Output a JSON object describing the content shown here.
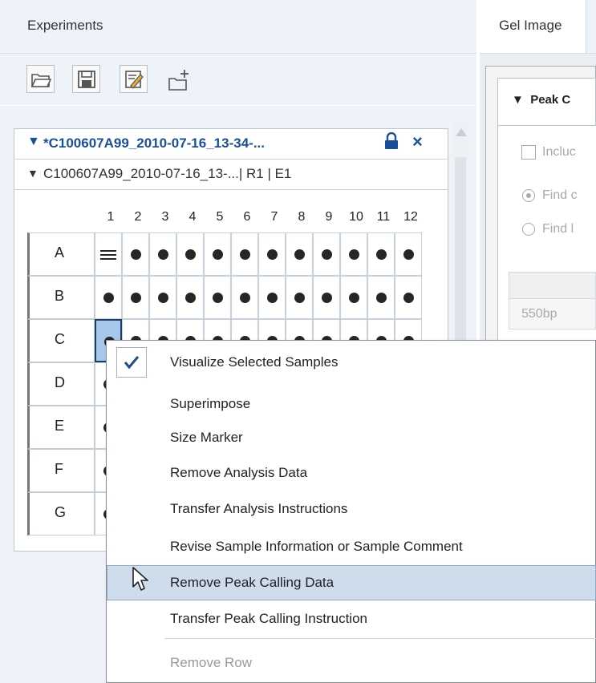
{
  "left_panel": {
    "header": {
      "title": "Experiments"
    },
    "toolbar": {
      "icons": [
        "open-folder-icon",
        "save-icon",
        "edit-icon",
        "new-experiment-icon"
      ]
    },
    "experiment": {
      "title": "*C100607A99_2010-07-16_13-34-...",
      "subtitle": "C100607A99_2010-07-16_13-...| R1 | E1"
    },
    "plate": {
      "columns": [
        "1",
        "2",
        "3",
        "4",
        "5",
        "6",
        "7",
        "8",
        "9",
        "10",
        "11",
        "12"
      ],
      "rows": [
        {
          "label": "A"
        },
        {
          "label": "B"
        },
        {
          "label": "C"
        },
        {
          "label": "D"
        },
        {
          "label": "E"
        },
        {
          "label": "F"
        },
        {
          "label": "G"
        }
      ]
    }
  },
  "right_panel": {
    "header": {
      "tab": "Gel Image"
    },
    "peak_section": {
      "title": "Peak C",
      "checkbox_label": "Incluc",
      "radio_1": "Find c",
      "radio_2": "Find l",
      "table_value": "550bp"
    }
  },
  "context_menu": {
    "items": [
      {
        "label": "Visualize Selected Samples",
        "checked": true
      },
      {
        "label": "Superimpose"
      },
      {
        "label": "Size Marker"
      },
      {
        "label": "Remove Analysis Data"
      },
      {
        "label": "Transfer Analysis Instructions"
      },
      {
        "label": "Revise Sample Information or Sample Comment"
      },
      {
        "label": "Remove Peak Calling Data",
        "highlighted": true
      },
      {
        "label": "Transfer Peak Calling Instruction"
      },
      {
        "label": "Remove Row",
        "disabled": true
      }
    ]
  },
  "colors": {
    "accent": "#1b4e9a",
    "panel_bg": "#eef3f9",
    "selection": "#a8c7ec",
    "menu_highlight": "#cfdcec"
  }
}
